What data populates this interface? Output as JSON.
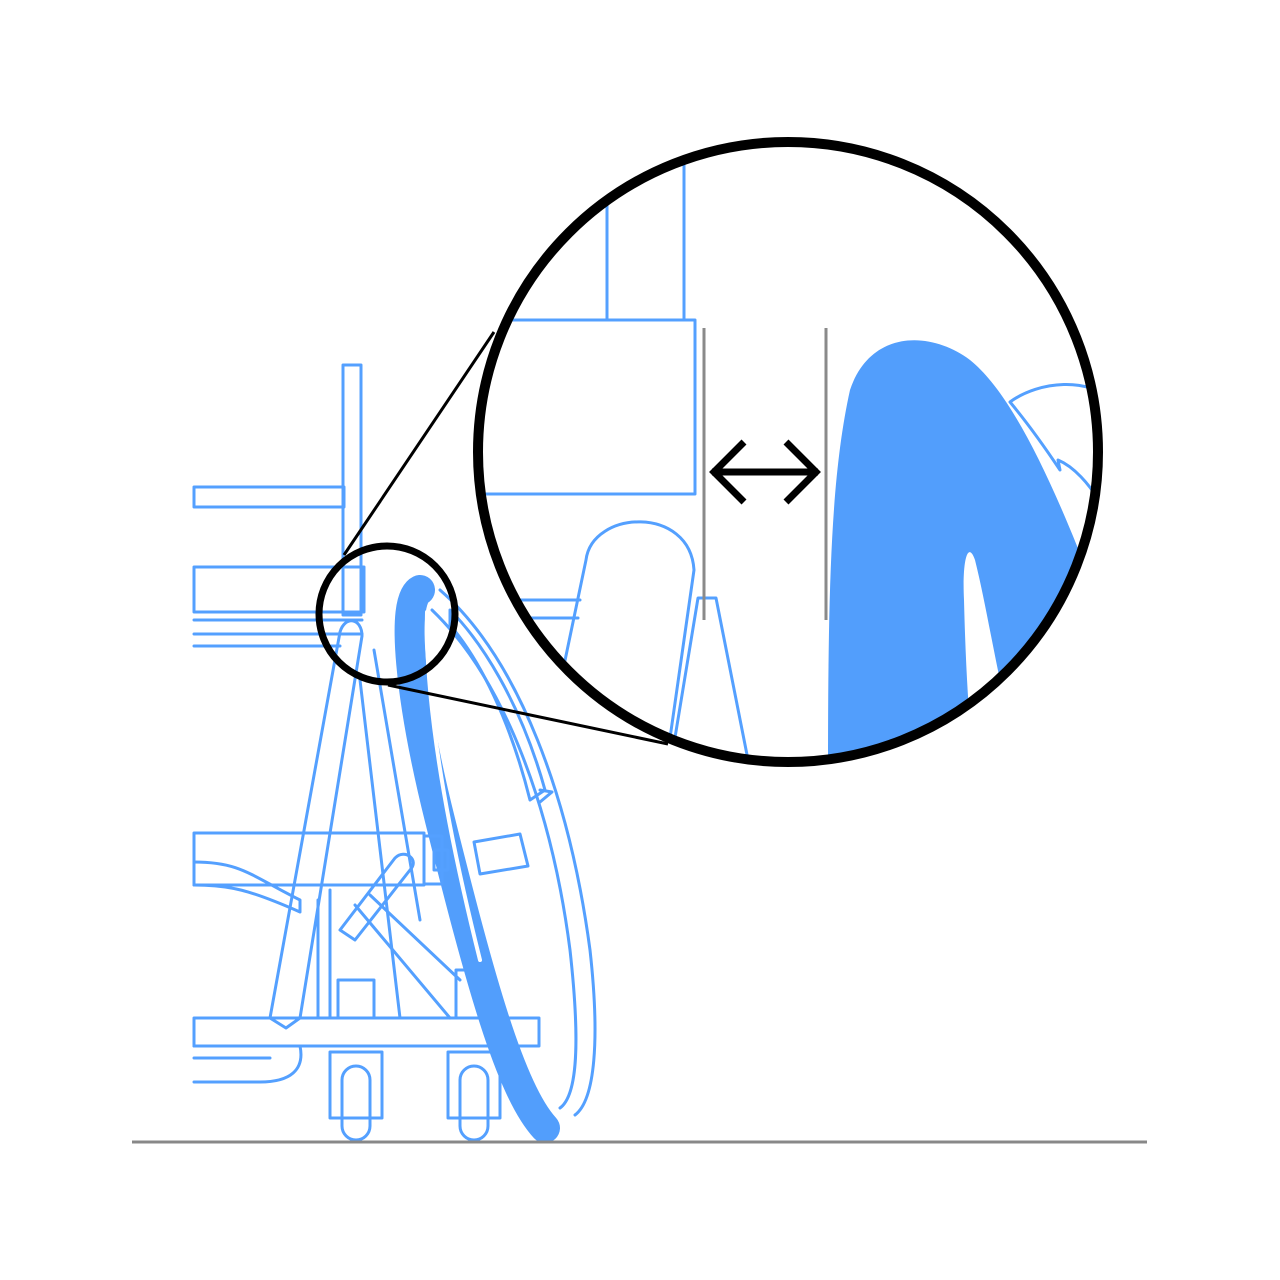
{
  "figure": {
    "subject": "wheelchair-side-view-with-magnified-detail",
    "colors": {
      "background": "#ffffff",
      "chair_line": "#54a0ff",
      "wheel_fill": "#529efc",
      "floor": "#888888",
      "outline": "#000000",
      "guide_line": "#8a8a8a"
    },
    "icons": {
      "magnifier": "magnifier-circle-icon",
      "gap_arrow": "double-headed-arrow-icon"
    }
  }
}
